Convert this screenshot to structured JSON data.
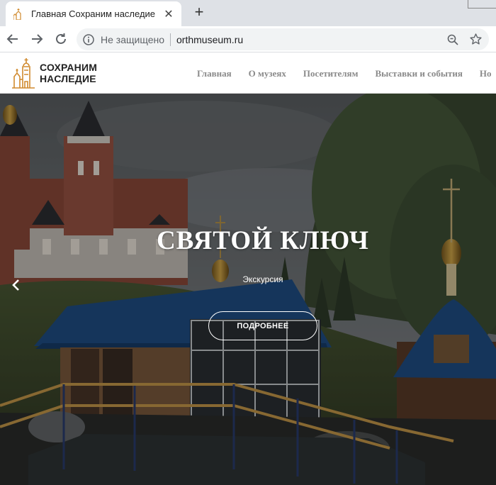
{
  "browser": {
    "tab_title": "Главная Сохраним наследие",
    "close_glyph": "✕",
    "new_tab_glyph": "+",
    "status": "Не защищено",
    "url": "orthmuseum.ru"
  },
  "site": {
    "logo_line1": "СОХРАНИМ",
    "logo_line2": "НАСЛЕДИЕ",
    "nav": [
      "Главная",
      "О музеях",
      "Посетителям",
      "Выставки и события",
      "Но"
    ]
  },
  "hero": {
    "title": "СВЯТОЙ КЛЮЧ",
    "subtitle": "Экскурсия",
    "button": "ПОДРОБНЕЕ"
  },
  "colors": {
    "accent_gold": "#d08a2e",
    "roof_blue": "#1f4f86"
  }
}
